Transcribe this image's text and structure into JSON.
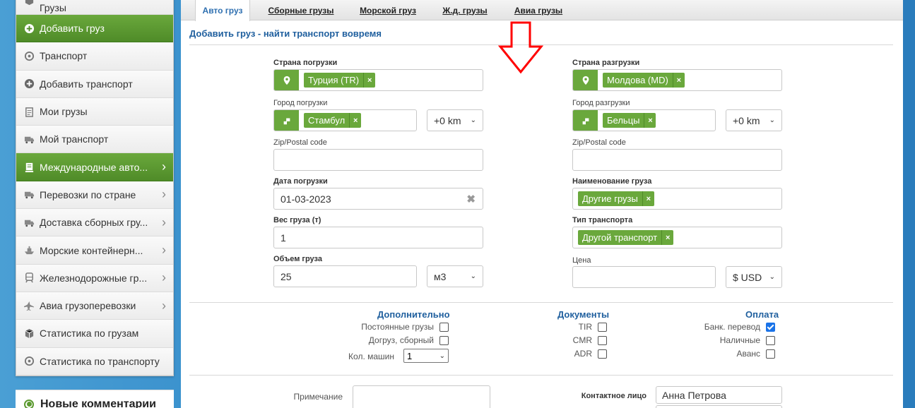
{
  "sidebar": {
    "top_cut": "Грузы",
    "items": [
      {
        "label": "Добавить груз",
        "icon": "plus-circle-icon",
        "active": true
      },
      {
        "label": "Транспорт",
        "icon": "steering-wheel-icon"
      },
      {
        "label": "Добавить транспорт",
        "icon": "plus-circle-icon"
      },
      {
        "label": "Мои грузы",
        "icon": "clipboard-icon"
      },
      {
        "label": "Мой транспорт",
        "icon": "truck-icon"
      },
      {
        "label": "Международные авто...",
        "icon": "list-icon",
        "active": true,
        "arrow": "›"
      },
      {
        "label": "Перевозки по стране",
        "icon": "truck-icon",
        "arrow": "›"
      },
      {
        "label": "Доставка сборных гру...",
        "icon": "truck-icon",
        "arrow": "›"
      },
      {
        "label": "Морские контейнерн...",
        "icon": "ship-icon",
        "arrow": "›"
      },
      {
        "label": "Железнодорожные гр...",
        "icon": "train-icon",
        "arrow": "›"
      },
      {
        "label": "Авиа грузоперевозки",
        "icon": "plane-icon",
        "arrow": "›"
      },
      {
        "label": "Статистика по грузам",
        "icon": "box-icon"
      },
      {
        "label": "Статистика по транспорту",
        "icon": "steering-wheel-icon"
      }
    ],
    "comments_heading": "Новые комментарии"
  },
  "tabs": [
    "Авто груз",
    "Сборные грузы",
    "Морской груз",
    "Ж.д. грузы",
    "Авиа грузы"
  ],
  "page_title": "Добавить груз - найти транспорт вовремя",
  "form": {
    "loading_country_label": "Страна погрузки",
    "loading_country_tag": "Турция (TR)",
    "unloading_country_label": "Страна разгрузки",
    "unloading_country_tag": "Молдова (MD)",
    "loading_city_label": "Город погрузки",
    "loading_city_tag": "Стамбул",
    "loading_radius": "+0 km",
    "unloading_city_label": "Город разгрузки",
    "unloading_city_tag": "Бельцы",
    "unloading_radius": "+0 km",
    "zip_label_left": "Zip/Postal code",
    "zip_label_right": "Zip/Postal code",
    "date_label": "Дата погрузки",
    "date_value": "01-03-2023",
    "cargo_name_label": "Наименование груза",
    "cargo_name_tag": "Другие грузы",
    "weight_label": "Вес груза (т)",
    "weight_value": "1",
    "transport_type_label": "Тип транспорта",
    "transport_type_tag": "Другой транспорт",
    "volume_label": "Объем груза",
    "volume_value": "25",
    "volume_unit": "м3",
    "price_label": "Цена",
    "currency": "$ USD",
    "remove_glyph": "×",
    "clear_glyph": "✖",
    "select_glyph": "⌄"
  },
  "extra": {
    "heading": "Дополнительно",
    "regular_label": "Постоянные грузы",
    "groupage_label": "Догруз, сборный",
    "trucks_label": "Кол. машин",
    "trucks_value": "1"
  },
  "documents": {
    "heading": "Документы",
    "items": [
      "TIR",
      "CMR",
      "ADR"
    ]
  },
  "payment": {
    "heading": "Оплата",
    "items": [
      {
        "label": "Банк. перевод",
        "checked": true
      },
      {
        "label": "Наличные",
        "checked": false
      },
      {
        "label": "Аванс",
        "checked": false
      }
    ]
  },
  "note_label": "Примечание",
  "contact_label": "Контактное лицо",
  "contact_value": "Анна Петрова",
  "colors": {
    "green": "#6aa83c",
    "blue_title": "#1f5f9e",
    "arrow_red": "#ff0000",
    "background": "#2e86c8"
  }
}
